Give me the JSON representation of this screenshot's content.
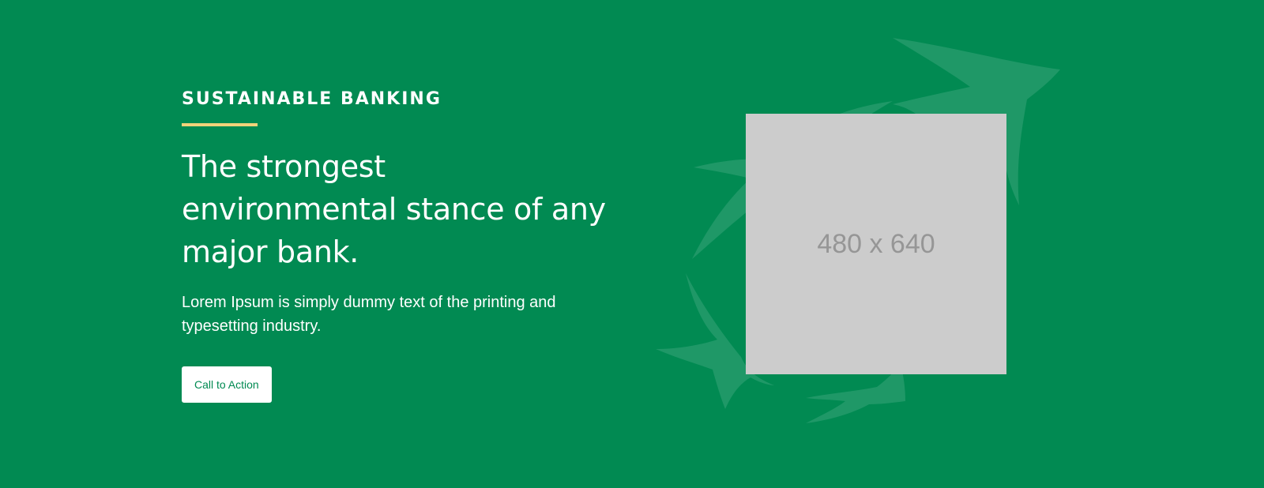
{
  "hero": {
    "eyebrow": "SUSTAINABLE BANKING",
    "headline": "The strongest environmental stance of any major bank.",
    "body": "Lorem Ipsum is simply dummy text of the printing and typesetting industry.",
    "cta_label": "Call to Action",
    "image_placeholder_label": "480 x 640"
  },
  "icons": {
    "decoration": "birds-logo-icon"
  },
  "colors": {
    "background": "#018A52",
    "accent_rule": "#F2D27A",
    "cta_background": "#FFFFFF",
    "cta_text": "#018A52",
    "placeholder_background": "#CCCCCC",
    "placeholder_text": "#969696"
  }
}
